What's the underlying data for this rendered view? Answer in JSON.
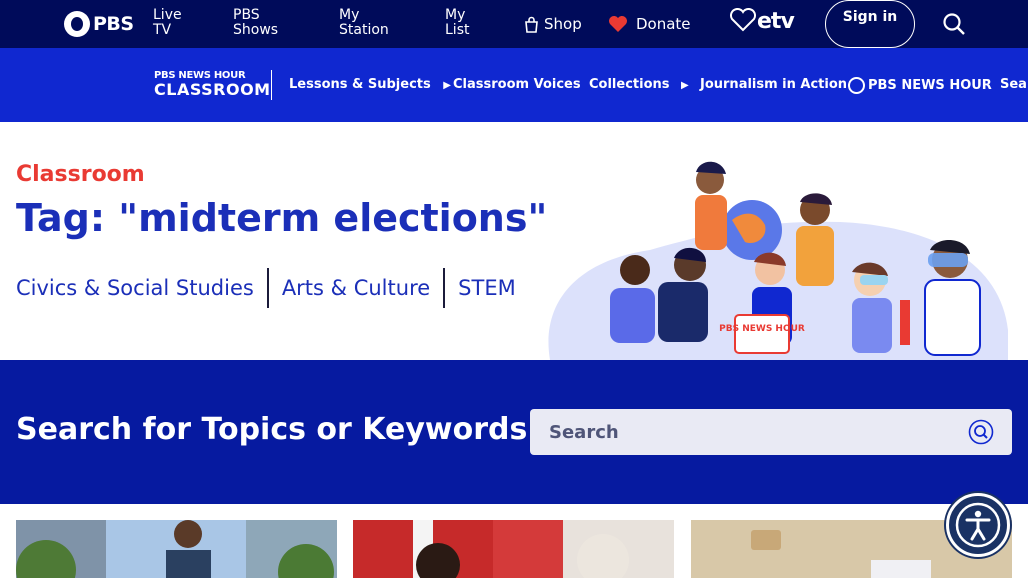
{
  "topnav": {
    "brand": "PBS",
    "items": [
      "Live TV",
      "PBS Shows",
      "My Station",
      "My List"
    ],
    "shop": "Shop",
    "donate": "Donate",
    "station": "etv",
    "signin": "Sign in"
  },
  "newshour_nav": {
    "logo_top": "PBS NEWS HOUR",
    "logo_bottom": "CLASSROOM",
    "items": [
      "Lessons & Subjects",
      "Classroom Voices",
      "Collections",
      "Journalism in Action"
    ],
    "arrow": "▶",
    "newshour_logo": "PBS NEWS HOUR",
    "search": "Search"
  },
  "header": {
    "kicker": "Classroom",
    "title": "Tag: \"midterm elections\"",
    "categories": [
      "Civics & Social Studies",
      "Arts & Culture",
      "STEM"
    ]
  },
  "illustration": {
    "sign_text": "PBS NEWS HOUR"
  },
  "search_section": {
    "heading": "Search for Topics or Keywords",
    "placeholder": "Search"
  },
  "colors": {
    "top_bar": "#000b5a",
    "newshour_bar": "#1028d0",
    "search_band": "#061aa0",
    "accent_red": "#e93a33",
    "title_blue": "#1b2fb8"
  },
  "icons": [
    "pbs-logo-icon",
    "shop-bag-icon",
    "heart-icon",
    "etv-heart-icon",
    "search-icon",
    "accessibility-icon"
  ]
}
